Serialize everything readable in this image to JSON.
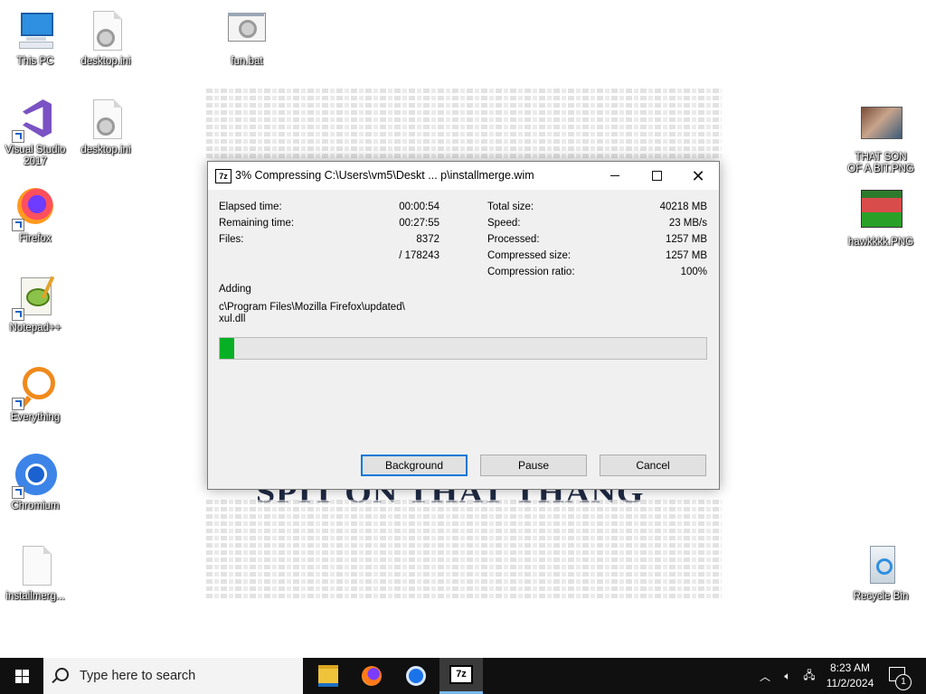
{
  "desktop": {
    "icons": [
      {
        "label": "This PC"
      },
      {
        "label": "desktop.ini"
      },
      {
        "label": "fun.bat"
      },
      {
        "label": "Visual Studio 2017"
      },
      {
        "label": "desktop.ini"
      },
      {
        "label": "Firefox"
      },
      {
        "label": "Notepad++"
      },
      {
        "label": "Everything"
      },
      {
        "label": "Chromium"
      },
      {
        "label": "installmerg..."
      },
      {
        "label": "THAT SON OF A BIT.PNG"
      },
      {
        "label": "hawkkkk.PNG"
      },
      {
        "label": "Recycle Bin"
      }
    ],
    "wallpaper_title": "SPIT ON THAT THANG"
  },
  "dialog": {
    "title": "3% Compressing C:\\Users\\vm5\\Deskt ... p\\installmerge.wim",
    "left_stats": [
      {
        "label": "Elapsed time:",
        "value": "00:00:54"
      },
      {
        "label": "Remaining time:",
        "value": "00:27:55"
      },
      {
        "label": "Files:",
        "value": "8372"
      },
      {
        "label": "",
        "value": "/ 178243"
      }
    ],
    "right_stats": [
      {
        "label": "Total size:",
        "value": "40218 MB"
      },
      {
        "label": "Speed:",
        "value": "23 MB/s"
      },
      {
        "label": "Processed:",
        "value": "1257 MB"
      },
      {
        "label": "Compressed size:",
        "value": "1257 MB"
      },
      {
        "label": "Compression ratio:",
        "value": "100%"
      }
    ],
    "operation": "Adding",
    "current_file_line1": "c\\Program Files\\Mozilla Firefox\\updated\\",
    "current_file_line2": "xul.dll",
    "progress_fraction": 0.03,
    "progress_color": "#06b025",
    "buttons": {
      "background": "Background",
      "pause": "Pause",
      "cancel": "Cancel"
    }
  },
  "taskbar": {
    "search_placeholder": "Type here to search",
    "time": "8:23 AM",
    "date": "11/2/2024",
    "notification_count": "1",
    "apps": [
      "file-explorer-icon",
      "firefox-icon",
      "chromium-icon",
      "7zip-icon"
    ]
  }
}
